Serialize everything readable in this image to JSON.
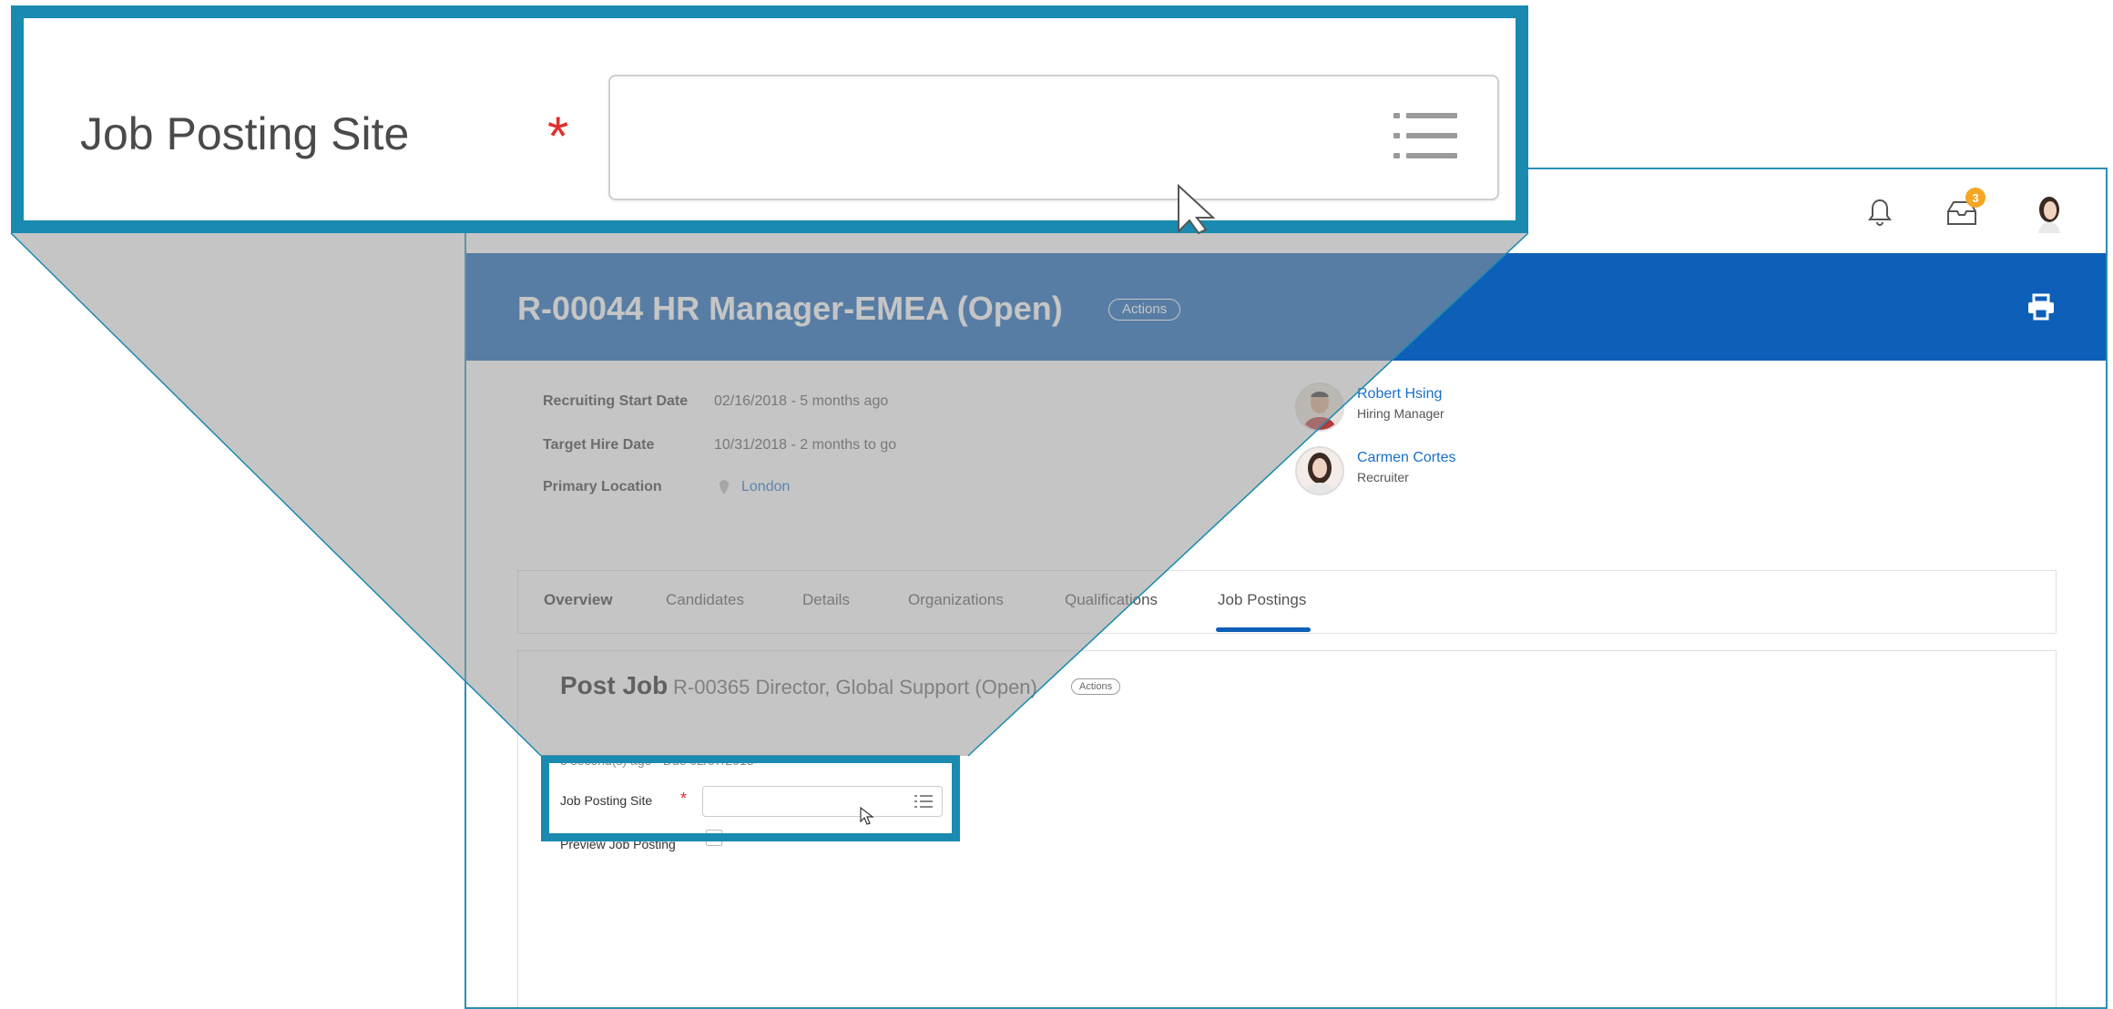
{
  "zoom": {
    "field_label": "Job Posting Site",
    "required_mark": "*",
    "input_value": "",
    "prompt_icon": "list-prompt-icon"
  },
  "topbar": {
    "icons": [
      "bell-icon",
      "inbox-icon",
      "profile-avatar"
    ],
    "inbox_badge": "3"
  },
  "header": {
    "title": "R-00044 HR Manager-EMEA (Open)",
    "actions_label": "Actions",
    "print_icon": "print-icon",
    "band_color": "#0d5fb8"
  },
  "details": [
    {
      "label": "Recruiting Start Date",
      "value": "02/16/2018 - 5 months ago"
    },
    {
      "label": "Target Hire Date",
      "value": "10/31/2018 - 2 months to go"
    },
    {
      "label": "Primary Location",
      "value": "London"
    }
  ],
  "people": [
    {
      "name": "Robert Hsing",
      "role": "Hiring Manager"
    },
    {
      "name": "Carmen Cortes",
      "role": "Recruiter"
    }
  ],
  "tabs": [
    "Overview",
    "Candidates",
    "Details",
    "Organizations",
    "Qualifications",
    "Job Postings"
  ],
  "active_tab": "Job Postings",
  "post_job": {
    "title": "Post Job",
    "subtitle": "R-00365 Director, Global Support (Open)",
    "actions_label": "Actions",
    "meta": "3 second(s) ago - Due 02/07/2018",
    "field_label": "Job Posting Site",
    "required_mark": "*",
    "preview_label": "Preview Job Posting"
  },
  "colors": {
    "highlight": "#1a8ab0",
    "required": "#e0302b",
    "link": "#1a6fc9"
  }
}
